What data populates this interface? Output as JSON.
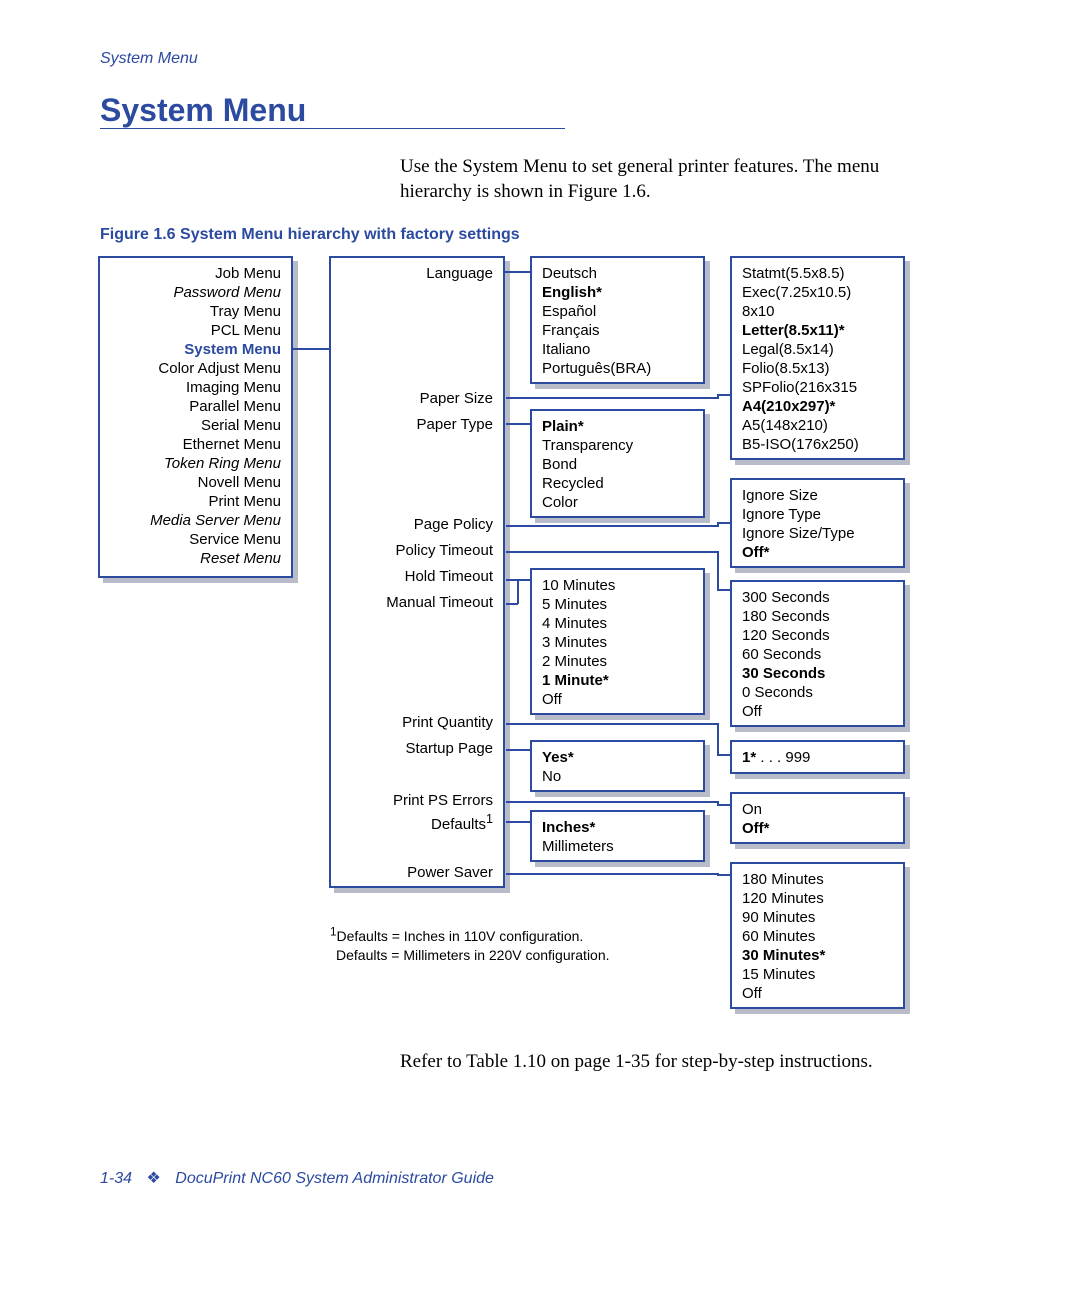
{
  "header_label": "System Menu",
  "title": "System Menu",
  "intro": "Use the System Menu to set general printer features. The menu hierarchy is shown in Figure 1.6.",
  "fig_caption": "Figure 1.6  System Menu hierarchy with factory settings",
  "main_menu": {
    "items": [
      {
        "label": "Job Menu",
        "italic": false
      },
      {
        "label": "Password Menu",
        "italic": true
      },
      {
        "label": "Tray Menu",
        "italic": false
      },
      {
        "label": "PCL Menu",
        "italic": false
      },
      {
        "label": "System Menu",
        "italic": false,
        "bold": true,
        "blue": true
      },
      {
        "label": "Color Adjust Menu",
        "italic": false
      },
      {
        "label": "Imaging Menu",
        "italic": false
      },
      {
        "label": "Parallel Menu",
        "italic": false
      },
      {
        "label": "Serial Menu",
        "italic": false
      },
      {
        "label": "Ethernet Menu",
        "italic": false
      },
      {
        "label": "Token Ring Menu",
        "italic": true
      },
      {
        "label": "Novell Menu",
        "italic": false
      },
      {
        "label": "Print Menu",
        "italic": false
      },
      {
        "label": "Media Server Menu",
        "italic": true
      },
      {
        "label": "Service Menu",
        "italic": false
      },
      {
        "label": "Reset Menu",
        "italic": true
      }
    ]
  },
  "sub_items": {
    "language": "Language",
    "paper_size": "Paper Size",
    "paper_type": "Paper Type",
    "page_policy": "Page Policy",
    "policy_timeout": "Policy Timeout",
    "hold_timeout": "Hold Timeout",
    "manual_timeout": "Manual Timeout",
    "print_quantity": "Print Quantity",
    "startup_page": "Startup Page",
    "print_ps_errors": "Print PS Errors",
    "defaults": "Defaults",
    "defaults_sup": "1",
    "power_saver": "Power Saver"
  },
  "language_opts": [
    {
      "label": "Deutsch"
    },
    {
      "label": "English*",
      "bold": true
    },
    {
      "label": "Español"
    },
    {
      "label": "Français"
    },
    {
      "label": "Italiano"
    },
    {
      "label": "Português(BRA)"
    }
  ],
  "paper_type_opts": [
    {
      "label": "Plain*",
      "bold": true
    },
    {
      "label": "Transparency"
    },
    {
      "label": "Bond"
    },
    {
      "label": "Recycled"
    },
    {
      "label": "Color"
    }
  ],
  "hold_timeout_opts": [
    {
      "label": "10 Minutes"
    },
    {
      "label": "5 Minutes"
    },
    {
      "label": "4 Minutes"
    },
    {
      "label": "3 Minutes"
    },
    {
      "label": "2 Minutes"
    },
    {
      "label": "1 Minute*",
      "bold": true
    },
    {
      "label": "Off"
    }
  ],
  "startup_opts": [
    {
      "label": "Yes*",
      "bold": true
    },
    {
      "label": "No"
    }
  ],
  "defaults_opts": [
    {
      "label": "Inches*",
      "bold": true
    },
    {
      "label": "Millimeters"
    }
  ],
  "paper_size_opts": [
    {
      "label": "Statmt(5.5x8.5)"
    },
    {
      "label": "Exec(7.25x10.5)"
    },
    {
      "label": "8x10"
    },
    {
      "label": "Letter(8.5x11)*",
      "bold": true
    },
    {
      "label": "Legal(8.5x14)"
    },
    {
      "label": "Folio(8.5x13)"
    },
    {
      "label": "SPFolio(216x315"
    },
    {
      "label": "A4(210x297)*",
      "bold": true
    },
    {
      "label": "A5(148x210)"
    },
    {
      "label": "B5-ISO(176x250)"
    }
  ],
  "page_policy_opts": [
    {
      "label": "Ignore Size"
    },
    {
      "label": "Ignore Type"
    },
    {
      "label": "Ignore Size/Type"
    },
    {
      "label": "Off*",
      "bold": true
    }
  ],
  "policy_timeout_opts": [
    {
      "label": "300 Seconds"
    },
    {
      "label": "180 Seconds"
    },
    {
      "label": "120 Seconds"
    },
    {
      "label": "60 Seconds"
    },
    {
      "label": "30 Seconds",
      "bold": true
    },
    {
      "label": "0 Seconds"
    },
    {
      "label": "Off"
    }
  ],
  "print_quantity_opts": [
    {
      "label": "1* . . . 999",
      "bold_prefix": "1*"
    }
  ],
  "ps_errors_opts": [
    {
      "label": "On"
    },
    {
      "label": "Off*",
      "bold": true
    }
  ],
  "power_saver_opts": [
    {
      "label": "180 Minutes"
    },
    {
      "label": "120 Minutes"
    },
    {
      "label": "90 Minutes"
    },
    {
      "label": "60 Minutes"
    },
    {
      "label": "30 Minutes*",
      "bold": true
    },
    {
      "label": "15 Minutes"
    },
    {
      "label": "Off"
    }
  ],
  "footnotes": {
    "sup": "1",
    "line1": "Defaults = Inches in 110V configuration.",
    "line2": "Defaults = Millimeters in 220V configuration."
  },
  "outro": "Refer to Table 1.10 on page 1-35 for step-by-step instructions.",
  "footer": {
    "page": "1-34",
    "diamond": "❖",
    "doc": "DocuPrint NC60 System Administrator Guide"
  }
}
